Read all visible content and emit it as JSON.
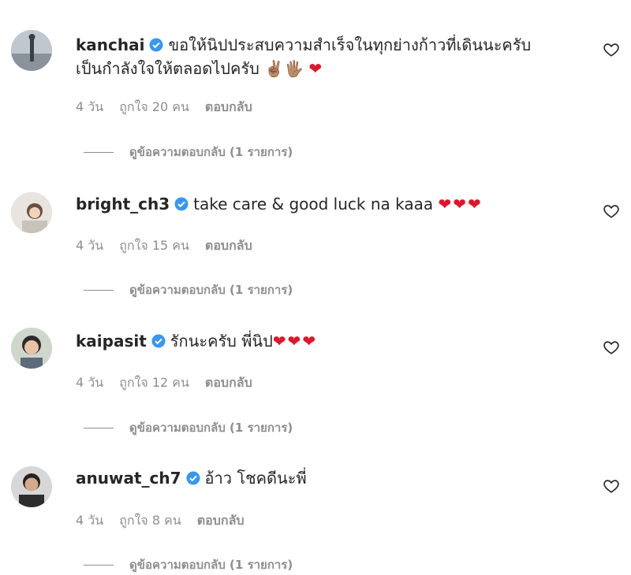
{
  "comments": [
    {
      "username": "kanchai",
      "text_line1": "ขอให้นิปประสบความสำเร็จในทุกย่างก้าวที่เดินนะครับ",
      "text_line2": "เป็นกำลังใจให้ตลอดไปครับ",
      "emoji": "✌🏽🖐🏽",
      "hearts": "❤",
      "time": "4 วัน",
      "likes": "ถูกใจ 20 คน",
      "reply": "ตอบกลับ",
      "view_replies": "ดูข้อความตอบกลับ (1 รายการ)"
    },
    {
      "username": "bright_ch3",
      "text_line1": "take care & good luck na kaaa",
      "hearts": "❤❤❤",
      "time": "4 วัน",
      "likes": "ถูกใจ 15 คน",
      "reply": "ตอบกลับ",
      "view_replies": "ดูข้อความตอบกลับ (1 รายการ)"
    },
    {
      "username": "kaipasit",
      "text_line1": "รักนะครับ พี่นิป",
      "hearts": "❤❤❤",
      "time": "4 วัน",
      "likes": "ถูกใจ 12 คน",
      "reply": "ตอบกลับ",
      "view_replies": "ดูข้อความตอบกลับ (1 รายการ)"
    },
    {
      "username": "anuwat_ch7",
      "text_line1": "อ้าว โชคดีนะพี่",
      "time": "4 วัน",
      "likes": "ถูกใจ 8 คน",
      "reply": "ตอบกลับ",
      "view_replies": "ดูข้อความตอบกลับ (1 รายการ)"
    }
  ],
  "colors": {
    "username": "#262626",
    "meta": "#8e8e8e",
    "verified": "#3897f0",
    "heart": "#e0162b"
  },
  "icons": {
    "verified": "verified-badge-icon",
    "like": "heart-outline-icon",
    "avatar": "profile-photo"
  }
}
